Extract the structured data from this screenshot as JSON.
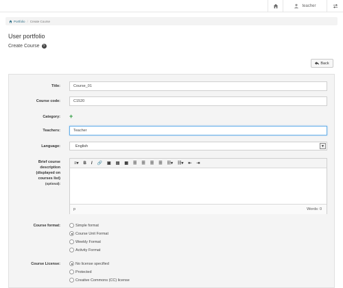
{
  "topbar": {
    "user_name": "teacher",
    "home_icon": "home-icon",
    "user_icon": "user-icon",
    "settings_icon": "sliders-icon"
  },
  "breadcrumb": {
    "home_label": "Portfolio",
    "current": "Create Course"
  },
  "page": {
    "title": "User portfolio",
    "subtitle": "Create Course",
    "back_label": "Back"
  },
  "form": {
    "title_label": "Title:",
    "title_value": "Course_01",
    "code_label": "Course code:",
    "code_value": "C1520",
    "category_label": "Category:",
    "teachers_label": "Teachers:",
    "teachers_value": "Teacher",
    "language_label": "Language:",
    "language_value": "English",
    "description_label_1": "Brief course",
    "description_label_2": "description",
    "description_label_3": "(displayed on",
    "description_label_4": "courses list)",
    "description_label_5": "(optional):",
    "editor_path": "p",
    "editor_words": "Words: 0",
    "format_label": "Course format:",
    "format_options": [
      "Simple format",
      "Course Unit Format",
      "Weekly Format",
      "Activity Format"
    ],
    "format_selected": "Course Unit Format",
    "license_label": "Course License:",
    "license_options": [
      "No license specified",
      "Protected",
      "Creative Commons (CC) license"
    ],
    "license_selected": "No license specified"
  },
  "colors": {
    "accent_link": "#2f6f87",
    "add_green": "#2b9a3e",
    "panel_bg": "#f4f4f4"
  }
}
